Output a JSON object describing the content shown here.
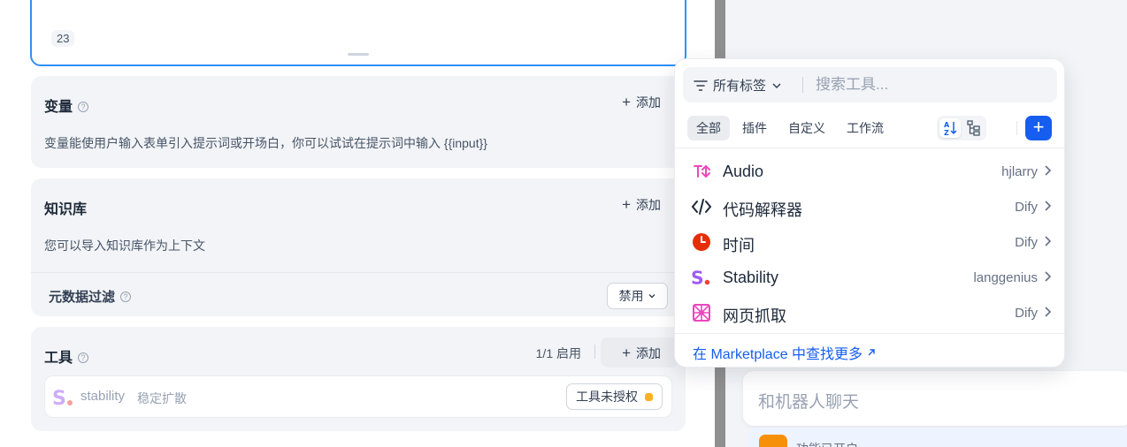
{
  "prompt": {
    "char_count": "23"
  },
  "variables": {
    "title": "变量",
    "add_label": "添加",
    "description": "变量能使用户输入表单引入提示词或开场白，你可以试试在提示词中输入 {{input}}"
  },
  "knowledge": {
    "title": "知识库",
    "add_label": "添加",
    "description": "您可以导入知识库作为上下文",
    "metadata_filter": {
      "label": "元数据过滤",
      "value": "禁用"
    }
  },
  "tools": {
    "title": "工具",
    "enabled_count": "1/1 启用",
    "add_label": "添加",
    "items": [
      {
        "name": "stability",
        "description": "稳定扩散",
        "status": "工具未授权"
      }
    ]
  },
  "tool_picker": {
    "tag_filter": "所有标签",
    "search_placeholder": "搜索工具...",
    "tabs": [
      "全部",
      "插件",
      "自定义",
      "工作流"
    ],
    "active_tab": "全部",
    "items": [
      {
        "name": "Audio",
        "author": "hjlarry",
        "icon": "audio-icon"
      },
      {
        "name": "代码解释器",
        "author": "Dify",
        "icon": "code-icon"
      },
      {
        "name": "时间",
        "author": "Dify",
        "icon": "clock-icon"
      },
      {
        "name": "Stability",
        "author": "langgenius",
        "icon": "stability-icon"
      },
      {
        "name": "网页抓取",
        "author": "Dify",
        "icon": "webscraper-icon"
      }
    ],
    "marketplace_link": "在 Marketplace 中查找更多"
  },
  "chat": {
    "placeholder": "和机器人聊天",
    "opener_text": "功能已开启"
  },
  "colors": {
    "accent": "#155eef",
    "focus_border": "#2e90fa",
    "warning": "#fdb022",
    "card_bg": "#f2f4f7"
  }
}
